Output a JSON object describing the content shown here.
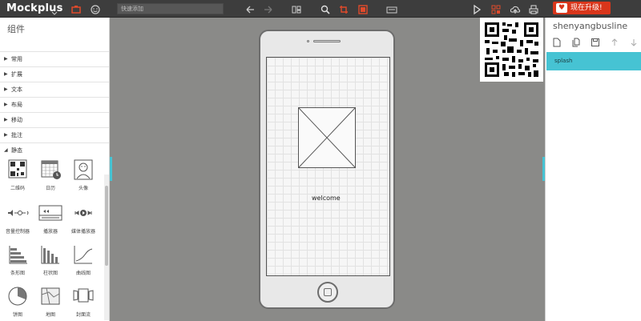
{
  "app": {
    "logo": "Mockplus",
    "search_placeholder": "快速添加",
    "upgrade_label": "现在升级!"
  },
  "left_panel": {
    "title": "组件",
    "categories": [
      "常用",
      "扩展",
      "文本",
      "布局",
      "移动",
      "批注",
      "静态"
    ],
    "static_items": [
      "二维码",
      "日历",
      "头像",
      "音量控制器",
      "播放器",
      "媒体播放器",
      "条形图",
      "柱状图",
      "曲线图",
      "饼图",
      "地图",
      "封面流"
    ]
  },
  "canvas": {
    "screen_text": "welcome"
  },
  "right_panel": {
    "project_title": "shenyangbusline",
    "pages": [
      "splash"
    ]
  },
  "colors": {
    "accent": "#46c3d3",
    "upgrade": "#d9361b",
    "toolbar": "#3d3d3d"
  }
}
